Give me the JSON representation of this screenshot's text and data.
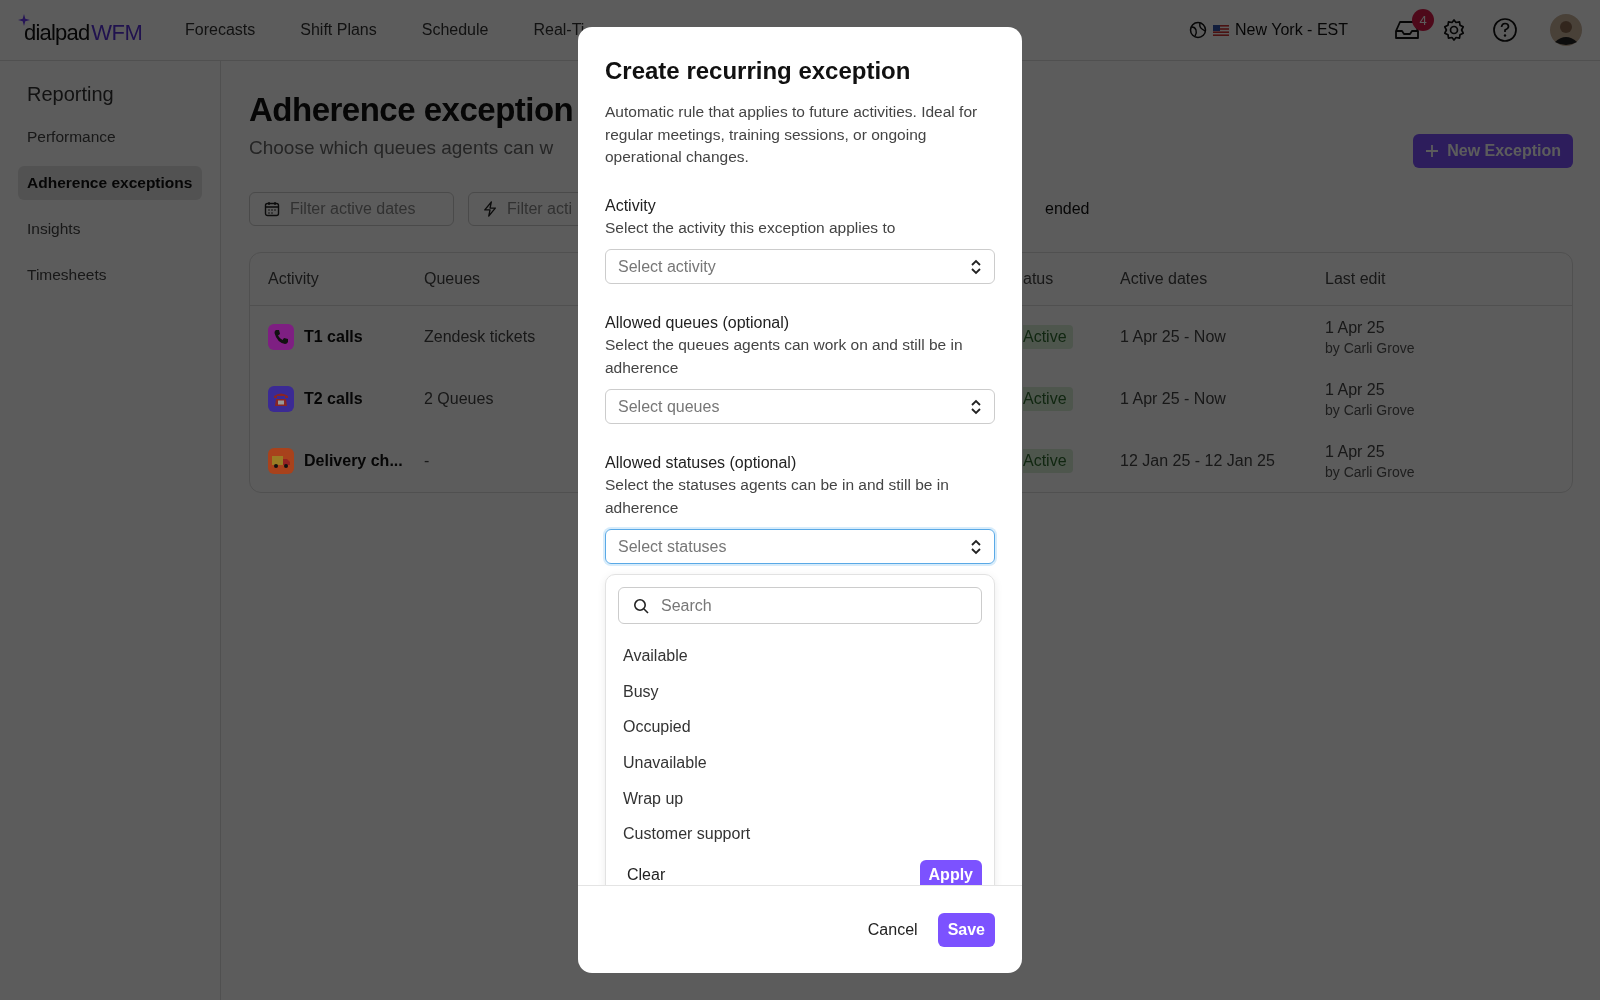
{
  "topbar": {
    "logo": {
      "brand": "dialpad",
      "product": "WFM"
    },
    "nav": [
      {
        "label": "Forecasts",
        "selected": false
      },
      {
        "label": "Shift Plans",
        "selected": false
      },
      {
        "label": "Schedule",
        "selected": false
      },
      {
        "label": "Real-Ti",
        "selected": false
      }
    ],
    "timezone": "New York - EST",
    "inbox_count": "4"
  },
  "sidebar": {
    "title": "Reporting",
    "items": [
      {
        "label": "Performance",
        "selected": false
      },
      {
        "label": "Adherence exceptions",
        "selected": true
      },
      {
        "label": "Insights",
        "selected": false
      },
      {
        "label": "Timesheets",
        "selected": false
      }
    ]
  },
  "main": {
    "title": "Adherence exception",
    "subtitle": "Choose which queues agents can w",
    "new_button": "New Exception",
    "filters": [
      {
        "kind": "dates",
        "placeholder": "Filter active dates"
      },
      {
        "kind": "activity",
        "placeholder": "Filter acti"
      }
    ],
    "filter_tail": "ended",
    "table": {
      "columns": [
        "Activity",
        "Queues",
        "atus",
        "Active dates",
        "Last edit"
      ],
      "rows": [
        {
          "activity": "T1 calls",
          "kind": "phone",
          "color": "#7e1f82",
          "queues": "Zendesk tickets",
          "status": "Active",
          "active_dates": "1 Apr 25 - Now",
          "edited": "1 Apr 25",
          "edited_by": "by Carli Grove"
        },
        {
          "activity": "T2 calls",
          "kind": "deskphone",
          "color": "#3b2a94",
          "queues": "2 Queues",
          "status": "Active",
          "active_dates": "1 Apr 25 - Now",
          "edited": "1 Apr 25",
          "edited_by": "by Carli Grove"
        },
        {
          "activity": "Delivery ch...",
          "kind": "truck",
          "color": "#a8421c",
          "queues": "-",
          "status": "Active",
          "active_dates": "12 Jan 25 - 12 Jan 25",
          "edited": "1 Apr 25",
          "edited_by": "by Carli Grove"
        }
      ]
    }
  },
  "dialog": {
    "title": "Create recurring exception",
    "description": "Automatic rule that applies to future activities. Ideal for regular meetings, training sessions, or ongoing operational changes.",
    "fields": [
      {
        "label": "Activity",
        "hint": "Select the activity this exception applies to",
        "placeholder": "Select activity",
        "focused": false
      },
      {
        "label": "Allowed queues (optional)",
        "hint": "Select the queues agents can work on and still be in adherence",
        "placeholder": "Select queues",
        "focused": false
      },
      {
        "label": "Allowed statuses (optional)",
        "hint": "Select the statuses agents can be in and still be in adherence",
        "placeholder": "Select statuses",
        "focused": true
      }
    ],
    "dropdown": {
      "search_placeholder": "Search",
      "options": [
        "Available",
        "Busy",
        "Occupied",
        "Unavailable",
        "Wrap up",
        "Customer support"
      ],
      "clear": "Clear",
      "apply": "Apply"
    },
    "buttons": {
      "cancel": "Cancel",
      "save": "Save"
    }
  }
}
